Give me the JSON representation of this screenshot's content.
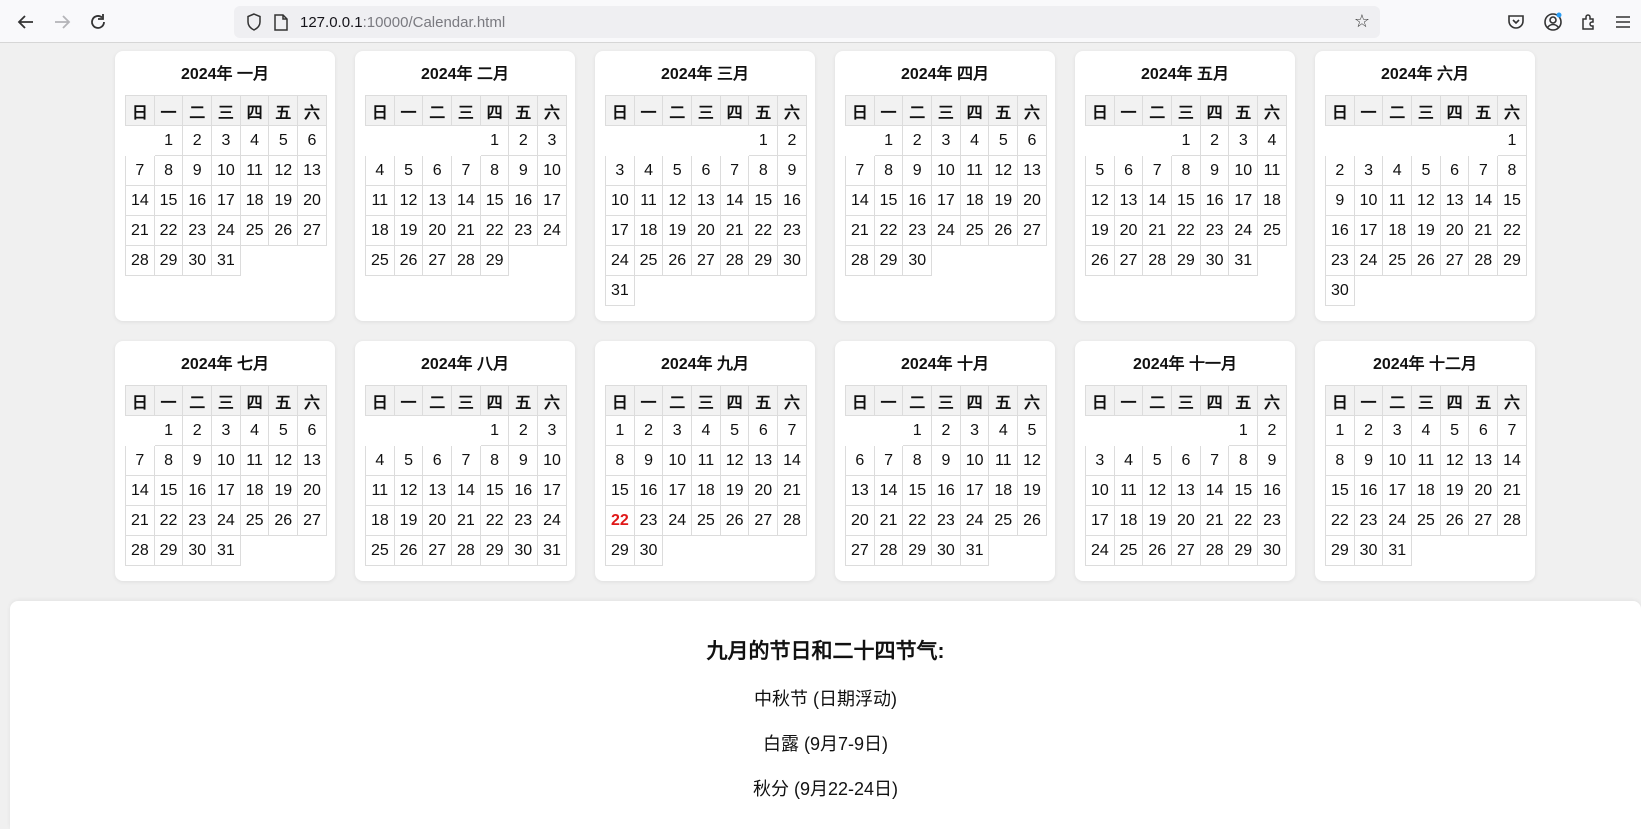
{
  "browser": {
    "url_host": "127.0.0.1",
    "url_rest": ":10000/Calendar.html",
    "icons": [
      "back-icon",
      "forward-icon",
      "reload-icon",
      "shield-icon",
      "page-icon",
      "bookmark-star-icon",
      "pocket-icon",
      "account-icon",
      "extensions-icon",
      "menu-icon"
    ]
  },
  "calendar": {
    "year_label": "2024年",
    "weekday_headers": [
      "日",
      "一",
      "二",
      "三",
      "四",
      "五",
      "六"
    ],
    "today": {
      "month_index": 8,
      "day": 22
    },
    "accent_color": "#e01818",
    "months": [
      {
        "name": "一月",
        "start": 1,
        "days": 31
      },
      {
        "name": "二月",
        "start": 4,
        "days": 29
      },
      {
        "name": "三月",
        "start": 5,
        "days": 31
      },
      {
        "name": "四月",
        "start": 1,
        "days": 30
      },
      {
        "name": "五月",
        "start": 3,
        "days": 31
      },
      {
        "name": "六月",
        "start": 6,
        "days": 30
      },
      {
        "name": "七月",
        "start": 1,
        "days": 31
      },
      {
        "name": "八月",
        "start": 4,
        "days": 31
      },
      {
        "name": "九月",
        "start": 0,
        "days": 30
      },
      {
        "name": "十月",
        "start": 2,
        "days": 31
      },
      {
        "name": "十一月",
        "start": 5,
        "days": 30
      },
      {
        "name": "十二月",
        "start": 0,
        "days": 31
      }
    ]
  },
  "holidays": {
    "title": "九月的节日和二十四节气:",
    "items": [
      "中秋节 (日期浮动)",
      "白露 (9月7-9日)",
      "秋分 (9月22-24日)"
    ]
  }
}
